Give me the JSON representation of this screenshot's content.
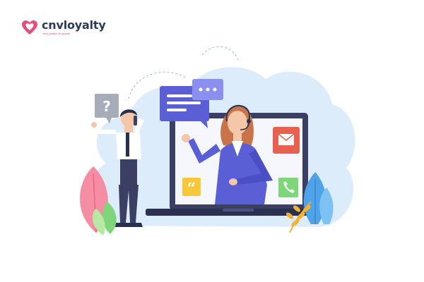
{
  "brand": {
    "name": "cnvloyalty",
    "tagline": "Your partner in growth",
    "color_primary": "#2e3a59",
    "color_accent": "#e24f7c"
  },
  "illustration": {
    "subject": "customer-support-agent-on-laptop",
    "icons": [
      "question-icon",
      "chat-bubble-icon",
      "typing-dots-icon",
      "mail-icon",
      "quote-icon",
      "phone-icon"
    ],
    "colors": {
      "blob": "#dcecfa",
      "laptop": "#3a3f63",
      "screen": "#f5f7fd",
      "suit": "#5b5fd6",
      "mail": "#e8604f",
      "quote": "#f7c93a",
      "phone": "#7fd67a"
    }
  }
}
